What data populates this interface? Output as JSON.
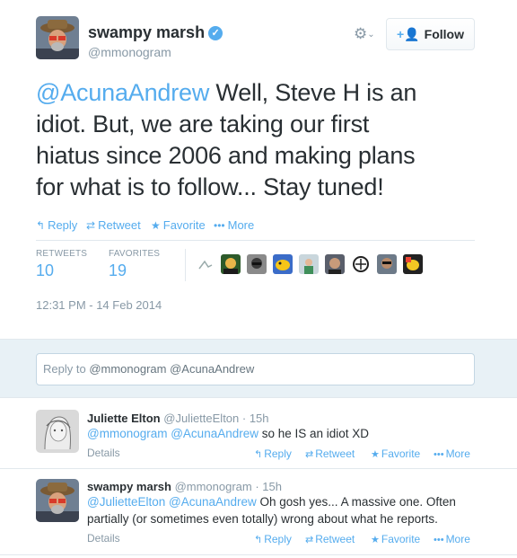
{
  "tweet": {
    "author_name": "swampy marsh",
    "verified_icon": "verified-badge-icon",
    "handle": "@mmonogram",
    "follow_label": "Follow",
    "text_mention": "@AcunaAndrew",
    "text_line1": " Well, Steve H is an",
    "text_line2": "idiot. But, we are taking our first",
    "text_line3": "hiatus since 2006 and making plans",
    "text_line4": "for what is to follow... Stay tuned!",
    "actions": {
      "reply": "Reply",
      "retweet": "Retweet",
      "favorite": "Favorite",
      "more": "More"
    },
    "stats": {
      "retweets_label": "RETWEETS",
      "retweets_value": "10",
      "favorites_label": "FAVORITES",
      "favorites_value": "19"
    },
    "timestamp": "12:31 PM - 14 Feb 2014"
  },
  "reply_box": {
    "prefix": "Reply to ",
    "mentions": "@mmonogram @AcunaAndrew"
  },
  "replies": [
    {
      "name": "Juliette Elton",
      "handle": "@JulietteElton · 15h",
      "mentions": "@mmonogram @AcunaAndrew",
      "text": " so he IS an idiot XD",
      "details": "Details",
      "reply": "Reply",
      "retweet": "Retweet",
      "favorite": "Favorite",
      "more": "More"
    },
    {
      "name": "swampy marsh",
      "handle": "@mmonogram · 15h",
      "mentions": "@JulietteElton @AcunaAndrew",
      "text": " Oh gosh yes... A massive one. Often partially (or sometimes even totally) wrong about what he reports.",
      "details": "Details",
      "reply": "Reply",
      "retweet": "Retweet",
      "favorite": "Favorite",
      "more": "More"
    }
  ],
  "colors": {
    "accent": "#55acee",
    "muted": "#8899a6",
    "text": "#292f33",
    "reply_zone": "#e8f1f6"
  }
}
